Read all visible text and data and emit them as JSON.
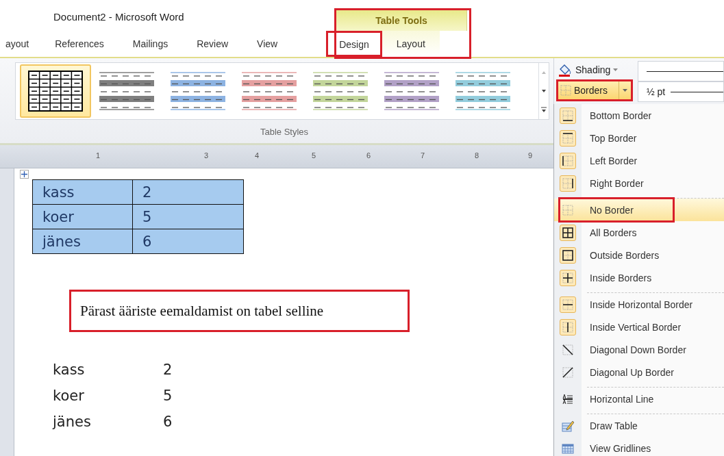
{
  "window": {
    "title": "Document2  -  Microsoft Word"
  },
  "contextual_tab_group": {
    "label": "Table Tools",
    "highlighted": true
  },
  "tabs": [
    {
      "label": "ayout",
      "contextual": false,
      "selected": false,
      "highlighted": false
    },
    {
      "label": "References",
      "contextual": false,
      "selected": false,
      "highlighted": false
    },
    {
      "label": "Mailings",
      "contextual": false,
      "selected": false,
      "highlighted": false
    },
    {
      "label": "Review",
      "contextual": false,
      "selected": false,
      "highlighted": false
    },
    {
      "label": "View",
      "contextual": false,
      "selected": false,
      "highlighted": false
    },
    {
      "label": "Design",
      "contextual": true,
      "selected": true,
      "highlighted": true
    },
    {
      "label": "Layout",
      "contextual": true,
      "selected": false,
      "highlighted": false
    }
  ],
  "ribbon": {
    "table_styles": {
      "label": "Table Styles",
      "styles": [
        {
          "kind": "grid",
          "color": "#000000",
          "selected": true
        },
        {
          "kind": "banded",
          "color": "#7f7f7f",
          "selected": false
        },
        {
          "kind": "banded",
          "color": "#8db3e2",
          "selected": false
        },
        {
          "kind": "banded",
          "color": "#e5a0a0",
          "selected": false
        },
        {
          "kind": "banded",
          "color": "#c3d69b",
          "selected": false
        },
        {
          "kind": "banded",
          "color": "#b2a1c7",
          "selected": false
        },
        {
          "kind": "banded",
          "color": "#93cddd",
          "selected": false
        }
      ]
    },
    "shading": {
      "label": "Shading"
    },
    "borders": {
      "label": "Borders",
      "open": true,
      "highlighted": true
    },
    "pen_weight": {
      "value": "½ pt"
    }
  },
  "ruler": {
    "labels": [
      "1",
      "3",
      "4",
      "5",
      "6",
      "7",
      "8",
      "9"
    ]
  },
  "document": {
    "table": {
      "selected": true,
      "rows": [
        [
          "kass",
          "2"
        ],
        [
          "koer",
          "5"
        ],
        [
          "jänes",
          "6"
        ]
      ]
    },
    "callout": {
      "text": "Pärast ääriste eemaldamist on tabel selline",
      "highlighted": true
    },
    "plain_rows": [
      [
        "kass",
        "2"
      ],
      [
        "koer",
        "5"
      ],
      [
        "jänes",
        "6"
      ]
    ]
  },
  "borders_menu": {
    "items": [
      {
        "label": "Bottom Border",
        "kind": "bottom",
        "on": true,
        "selected": false,
        "separator_before": false,
        "highlighted": false
      },
      {
        "label": "Top Border",
        "kind": "top",
        "on": true,
        "selected": false,
        "separator_before": false,
        "highlighted": false
      },
      {
        "label": "Left Border",
        "kind": "left",
        "on": true,
        "selected": false,
        "separator_before": false,
        "highlighted": false
      },
      {
        "label": "Right Border",
        "kind": "right",
        "on": true,
        "selected": false,
        "separator_before": false,
        "highlighted": false
      },
      {
        "label": "No Border",
        "kind": "none",
        "on": false,
        "selected": true,
        "separator_before": true,
        "highlighted": true
      },
      {
        "label": "All Borders",
        "kind": "all",
        "on": true,
        "selected": false,
        "separator_before": false,
        "highlighted": false
      },
      {
        "label": "Outside Borders",
        "kind": "outside",
        "on": true,
        "selected": false,
        "separator_before": false,
        "highlighted": false
      },
      {
        "label": "Inside Borders",
        "kind": "inside",
        "on": true,
        "selected": false,
        "separator_before": false,
        "highlighted": false
      },
      {
        "label": "Inside Horizontal Border",
        "kind": "inside-h",
        "on": true,
        "selected": false,
        "separator_before": true,
        "highlighted": false
      },
      {
        "label": "Inside Vertical Border",
        "kind": "inside-v",
        "on": true,
        "selected": false,
        "separator_before": false,
        "highlighted": false
      },
      {
        "label": "Diagonal Down Border",
        "kind": "diag-down",
        "on": false,
        "selected": false,
        "separator_before": false,
        "highlighted": false
      },
      {
        "label": "Diagonal Up Border",
        "kind": "diag-up",
        "on": false,
        "selected": false,
        "separator_before": false,
        "highlighted": false
      },
      {
        "label": "Horizontal Line",
        "kind": "hline",
        "on": false,
        "selected": false,
        "separator_before": true,
        "highlighted": false
      },
      {
        "label": "Draw Table",
        "kind": "draw",
        "on": false,
        "selected": false,
        "separator_before": true,
        "highlighted": false
      },
      {
        "label": "View Gridlines",
        "kind": "gridlines",
        "on": false,
        "selected": false,
        "separator_before": false,
        "highlighted": false
      }
    ]
  }
}
